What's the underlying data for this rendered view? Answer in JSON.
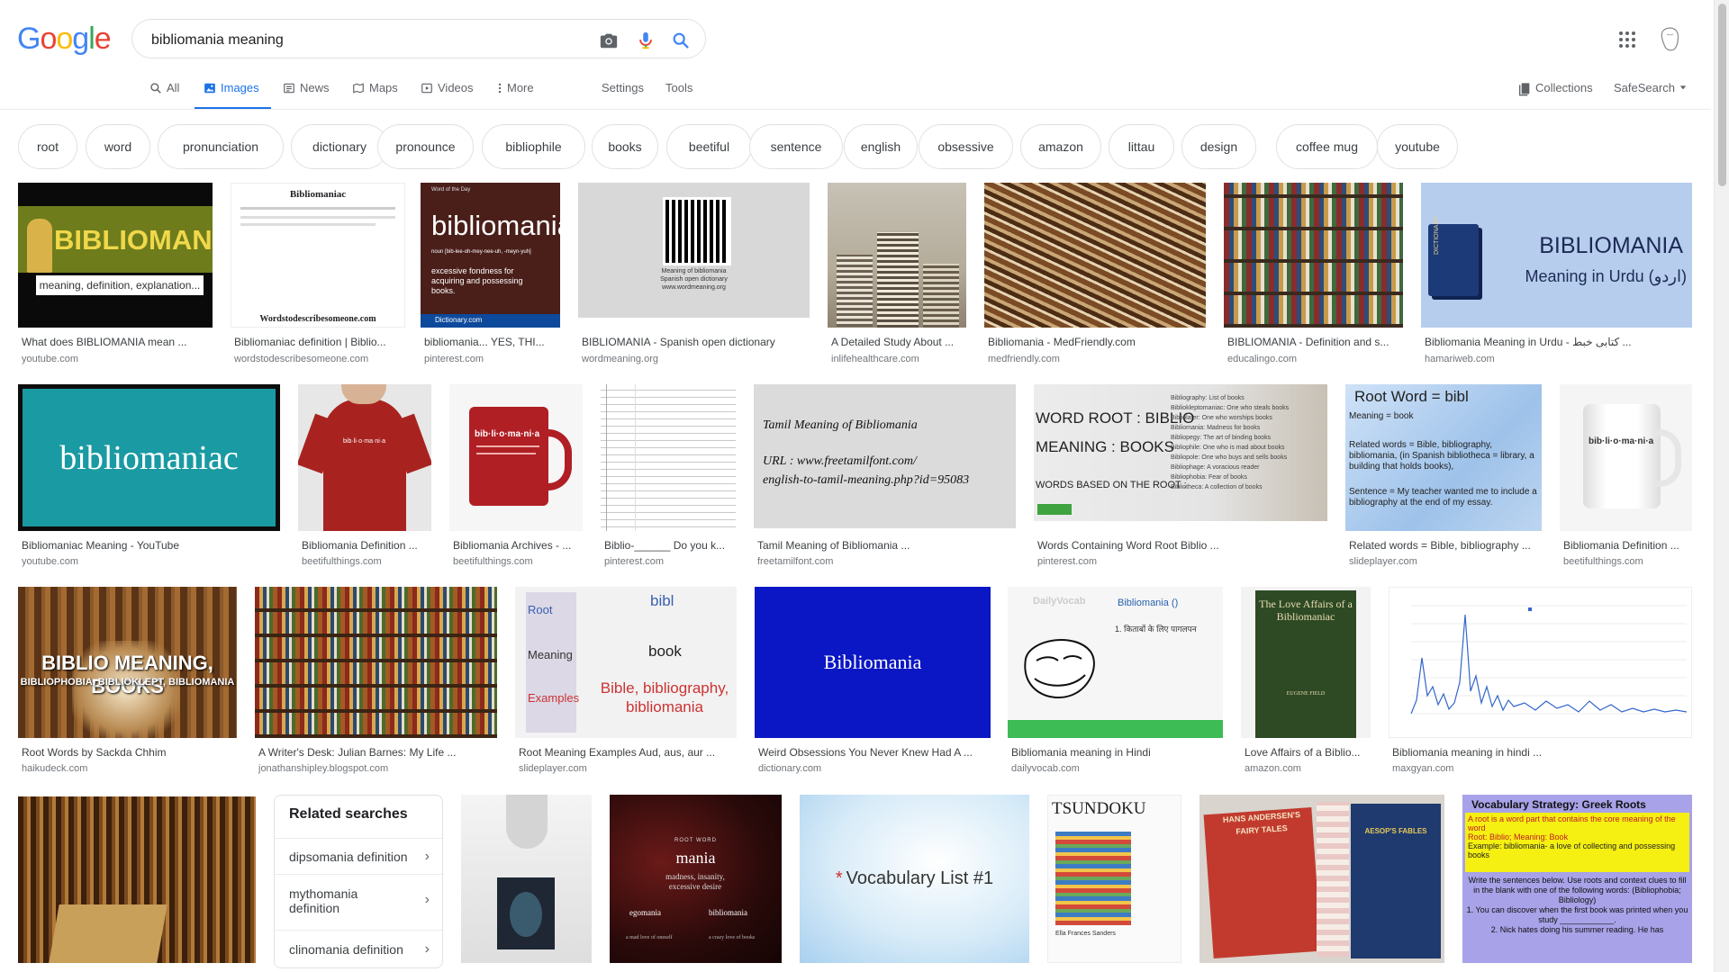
{
  "search": {
    "query": "bibliomania meaning"
  },
  "tabs": {
    "all": "All",
    "images": "Images",
    "news": "News",
    "maps": "Maps",
    "videos": "Videos",
    "more": "More",
    "settings": "Settings",
    "tools": "Tools"
  },
  "header_right": {
    "collections": "Collections",
    "safesearch": "SafeSearch"
  },
  "chips": [
    "root",
    "word",
    "pronunciation",
    "dictionary",
    "pronounce",
    "bibliophile",
    "books",
    "beetiful",
    "sentence",
    "english",
    "obsessive",
    "amazon",
    "littau",
    "design",
    "coffee mug",
    "youtube"
  ],
  "results": {
    "r1": {
      "title": "What does BIBLIOMANIA mean ...",
      "source": "youtube.com",
      "img_big": "BIBLIOMANIA",
      "img_small": "meaning, definition, explanation..."
    },
    "r2": {
      "title": "Bibliomaniac definition | Biblio...",
      "source": "wordstodescribesomeone.com",
      "img_head": "Bibliomaniac",
      "img_foot": "Wordstodescribesomeone.com"
    },
    "r3": {
      "title": "bibliomania... YES, THI...",
      "source": "pinterest.com",
      "img_top": "Word of the Day",
      "img_word": "bibliomania",
      "img_pron": "noun [bib-lee-oh-mey-nee-uh, -meyn-yuh]",
      "img_def": "excessive fondness for acquiring and possessing books.",
      "img_brand": "Dictionary.com"
    },
    "r4": {
      "title": "BIBLIOMANIA - Spanish open dictionary",
      "source": "wordmeaning.org",
      "img_l1": "Meaning of bibliomania",
      "img_l2": "Spanish open dictionary",
      "img_l3": "www.wordmeaning.org"
    },
    "r5": {
      "title": "A Detailed Study About ...",
      "source": "inlifehealthcare.com"
    },
    "r6": {
      "title": "Bibliomania - MedFriendly.com",
      "source": "medfriendly.com"
    },
    "r7": {
      "title": "BIBLIOMANIA - Definition and s...",
      "source": "educalingo.com"
    },
    "r8": {
      "title": "Bibliomania Meaning in Urdu - كتابی خبط ...",
      "source": "hamariweb.com",
      "img_big": "BIBLIOMANIA",
      "img_small": "Meaning in Urdu (اردو)",
      "img_book": "DICTIONARY"
    },
    "r9": {
      "title": "Bibliomaniac Meaning - YouTube",
      "source": "youtube.com",
      "img_word": "bibliomaniac"
    },
    "r10": {
      "title": "Bibliomania Definition ...",
      "source": "beetifulthings.com",
      "img_word": "bib·li·o·ma·ni·a"
    },
    "r11": {
      "title": "Bibliomania Archives - ...",
      "source": "beetifulthings.com",
      "img_word": "bib·li·o·ma·ni·a"
    },
    "r12": {
      "title": "Biblio-______ Do you k...",
      "source": "pinterest.com"
    },
    "r13": {
      "title": "Tamil Meaning of Bibliomania ...",
      "source": "freetamilfont.com",
      "img_l1": "Tamil Meaning of Bibliomania",
      "img_l2": "URL : www.freetamilfont.com/",
      "img_l3": "english-to-tamil-meaning.php?id=95083"
    },
    "r14": {
      "title": "Words Containing Word Root Biblio ...",
      "source": "pinterest.com",
      "img_l1": "WORD ROOT : BIBLIO",
      "img_l2": "MEANING : BOOKS",
      "img_l3": "WORDS BASED ON THE ROOT :",
      "img_list": [
        "Bibliography: List of books",
        "Bibliokleptomaniac: One who steals books",
        "Bibliolater: One who worships books",
        "Bibliomania: Madness for books",
        "Bibliopegy: The art of binding books",
        "Bibliophile: One who is mad about books",
        "Bibliopole: One who buys and sells books",
        "Bibliophage: A voracious reader",
        "Bibliophobia: Fear of books",
        "Bibliotheca: A collection of books"
      ]
    },
    "r15": {
      "title": "Related words = Bible, bibliography ...",
      "source": "slideplayer.com",
      "img_head": "Root Word = bibl",
      "img_sub": "Meaning = book",
      "img_body": "Related words = Bible, bibliography, bibliomania, (in Spanish bibliotheca = library, a building that holds books),",
      "img_body2": "Sentence = My teacher wanted me to include a bibliography at the end of my essay."
    },
    "r16": {
      "title": "Bibliomania Definition ...",
      "source": "beetifulthings.com",
      "img_word": "bib·li·o·ma·ni·a"
    },
    "r17": {
      "title": "Root Words by Sackda Chhim",
      "source": "haikudeck.com",
      "img_big": "BIBLIO MEANING, BOOKS",
      "img_small": "BIBLIOPHOBIA, BIBLIOKLEPT, BIBLIOMANIA"
    },
    "r18": {
      "title": "A Writer's Desk: Julian Barnes: My Life ...",
      "source": "jonathanshipley.blogspot.com"
    },
    "r19": {
      "title": "Root Meaning Examples Aud, aus, aur ...",
      "source": "slideplayer.com",
      "img_root": "Root",
      "img_meaning": "Meaning",
      "img_examples": "Examples",
      "img_bibl": "bibl",
      "img_book": "book",
      "img_ex": "Bible, bibliography, bibliomania"
    },
    "r20": {
      "title": "Weird Obsessions You Never Knew Had A ...",
      "source": "dictionary.com",
      "img_word": "Bibliomania"
    },
    "r21": {
      "title": "Bibliomania meaning in Hindi",
      "source": "dailyvocab.com",
      "img_word": "Bibliomania ()",
      "img_hindi": "1. किताबों के लिए पागलपन",
      "img_brand": "DailyVocab"
    },
    "r22": {
      "title": "Love Affairs of a Biblio...",
      "source": "amazon.com",
      "img_title": "The Love Affairs of a Bibliomaniac",
      "img_author": "EUGENE FIELD"
    },
    "r23": {
      "title": "Bibliomania meaning in hindi ...",
      "source": "maxgyan.com"
    },
    "row4": {
      "r25_word": "ROOT WORD",
      "r25_big": "mania",
      "r25_def": "madness, insanity, excessive desire",
      "r25_e1": "egomania",
      "r25_e2": "bibliomania",
      "r25_d1": "a mad love of oneself",
      "r25_d2": "a crazy love of books",
      "r26_text": "Vocabulary List #1",
      "r27_word": "TSUNDOKU",
      "r27_author": "Ella Frances Sanders",
      "r28_l1": "HANS ANDERSEN'S",
      "r28_l2": "FAIRY TALES",
      "r28_l3": "AESOP'S FABLES",
      "r29_title": "Vocabulary Strategy: Greek Roots",
      "r29_b1": "A root is a word part that contains the core meaning of the word",
      "r29_b2": "Root: Biblio; Meaning: Book",
      "r29_b3": "Example: bibliomania- a love of collecting and possessing books",
      "r29_p1": "Write the sentences below. Use roots and context clues to fill in the blank with one of the following words: (Bibliophobia; Bibliology)",
      "r29_p2": "1. You can discover when the first book was printed when you study ____________.",
      "r29_p3": "2. Nick hates doing his summer reading. He has"
    }
  },
  "related": {
    "title": "Related searches",
    "items": [
      "dipsomania definition",
      "mythomania definition",
      "clinomania definition"
    ]
  },
  "colors": {
    "accent": "#1a73e8",
    "text": "#202124",
    "secondary": "#70757a"
  }
}
